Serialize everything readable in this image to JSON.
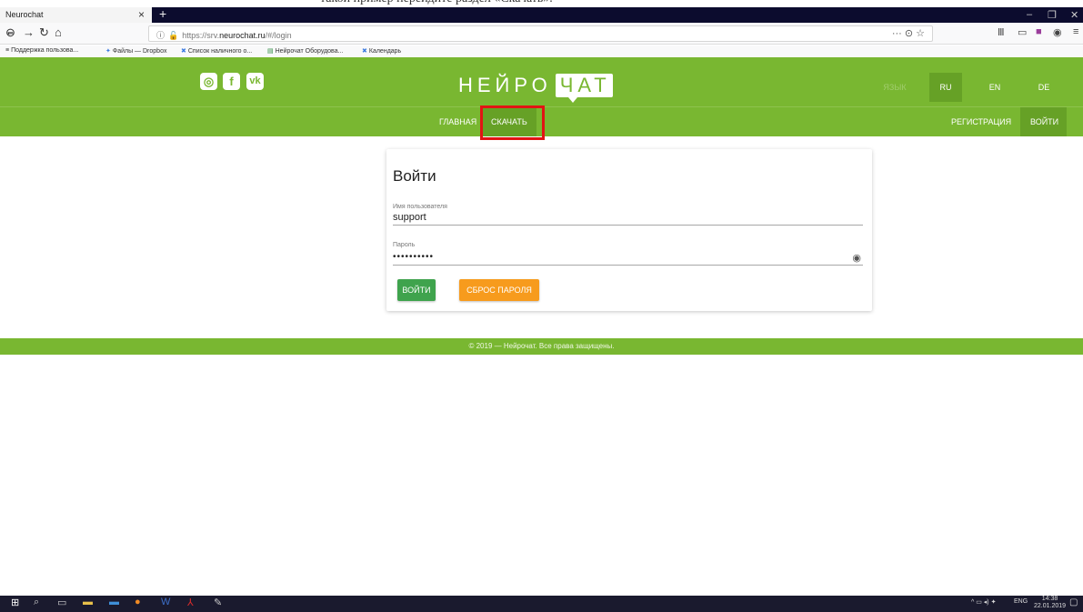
{
  "browser": {
    "tab_title": "Neurochat",
    "url_prefix": "https://srv.",
    "url_host": "neurochat.ru",
    "url_path": "/#/login",
    "url_right_icons": "··· ⊙ ☆"
  },
  "bookmarks": [
    {
      "icon": "≡",
      "label": "Поддержка пользова..."
    },
    {
      "icon": "✦",
      "label": "Файлы — Dropbox"
    },
    {
      "icon": "✖",
      "label": "Список наличного о..."
    },
    {
      "icon": "▤",
      "label": "Нейрочат Оборудова..."
    },
    {
      "icon": "✖",
      "label": "Календарь"
    }
  ],
  "site": {
    "logo_left": "НЕЙРО",
    "logo_right": "ЧАТ",
    "social": [
      "instagram-icon",
      "facebook-icon",
      "vk-icon"
    ],
    "language": {
      "label": "ЯЗЫК",
      "options": [
        "RU",
        "EN",
        "DE"
      ],
      "active": "RU"
    },
    "menu": {
      "home": "ГЛАВНАЯ",
      "download": "СКАЧАТЬ",
      "register": "РЕГИСТРАЦИЯ",
      "login": "ВОЙТИ"
    }
  },
  "login": {
    "title": "Войти",
    "username_label": "Имя пользователя",
    "username_value": "support",
    "password_label": "Пароль",
    "password_value": "••••••••••",
    "login_button": "ВОЙТИ",
    "reset_button": "СБРОС ПАРОЛЯ"
  },
  "footer": {
    "text": "© 2019 — Нейрочат. Все права защищены."
  },
  "taskbar": {
    "time": "14:38",
    "date": "22.01.2019",
    "lang": "ENG"
  },
  "colors": {
    "brand_green": "#79b731",
    "active_green": "#66a126",
    "button_green": "#3fa34d",
    "button_orange": "#f79b1d",
    "highlight_red": "#e21414"
  }
}
